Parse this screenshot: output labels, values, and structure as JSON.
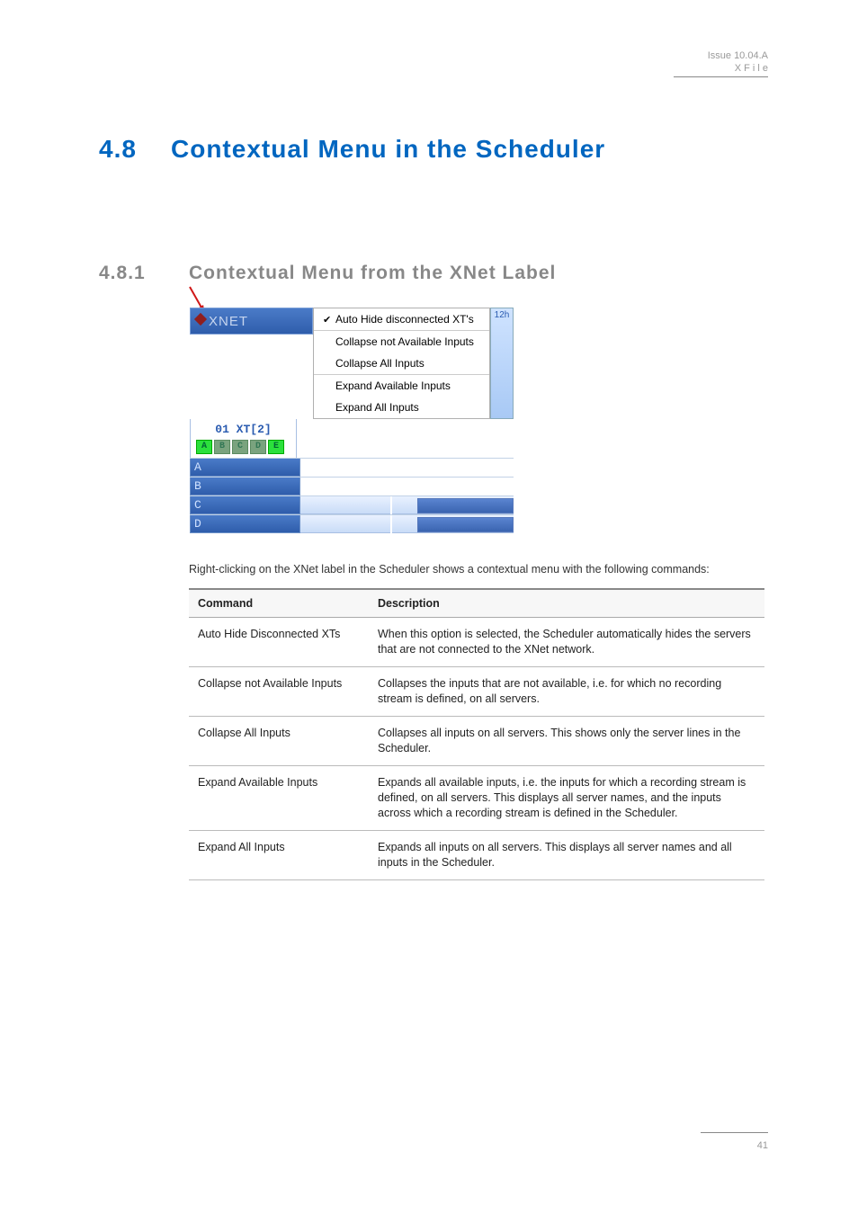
{
  "header": {
    "issue": "Issue 10.04.A",
    "product": "X F i l e"
  },
  "h1": {
    "num": "4.8",
    "title": "Contextual Menu in the Scheduler"
  },
  "h2": {
    "num": "4.8.1",
    "title": "Contextual Menu from the XNet Label"
  },
  "figure": {
    "xnet_label": "XNET",
    "time_label": "12h",
    "xt_label": "01 XT[2]",
    "chips": [
      "A",
      "B",
      "C",
      "D",
      "E"
    ],
    "rows": [
      "A",
      "B",
      "C",
      "D"
    ],
    "menu": {
      "auto_hide": "Auto Hide disconnected XT's",
      "collapse_na": "Collapse not Available Inputs",
      "collapse_all": "Collapse All Inputs",
      "expand_avail": "Expand Available Inputs",
      "expand_all": "Expand All Inputs"
    }
  },
  "para": "Right-clicking on the XNet label in the Scheduler shows a contextual menu with the following commands:",
  "table": {
    "h1": "Command",
    "h2": "Description",
    "rows": [
      {
        "cmd": "Auto Hide Disconnected XTs",
        "desc": "When this option is selected, the Scheduler automatically hides the servers that are not connected to the XNet network."
      },
      {
        "cmd": "Collapse not Available Inputs",
        "desc": "Collapses the inputs that are not available, i.e. for which no recording stream is defined, on all servers."
      },
      {
        "cmd": "Collapse All Inputs",
        "desc": "Collapses all inputs on all servers. This shows only the server lines in the Scheduler."
      },
      {
        "cmd": "Expand Available Inputs",
        "desc": "Expands all available inputs, i.e. the inputs for which a recording stream is defined, on all servers. This displays all server names, and the inputs across which a recording stream is defined in the Scheduler."
      },
      {
        "cmd": "Expand All Inputs",
        "desc": "Expands all inputs on all servers. This displays all server names and all inputs in the Scheduler."
      }
    ]
  },
  "footer": {
    "page": "41"
  }
}
